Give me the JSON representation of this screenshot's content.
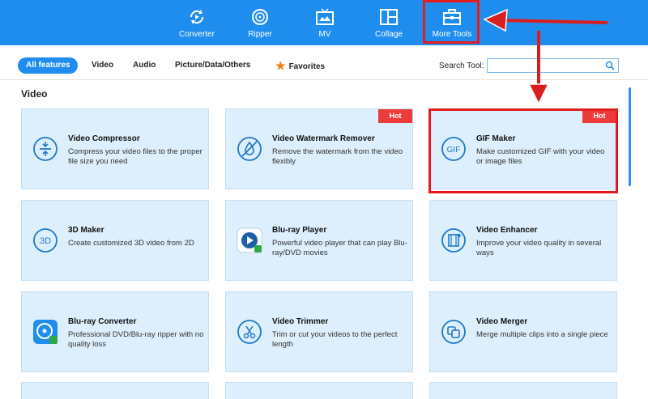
{
  "nav": {
    "items": [
      {
        "label": "Converter",
        "icon": "converter-icon"
      },
      {
        "label": "Ripper",
        "icon": "ripper-icon"
      },
      {
        "label": "MV",
        "icon": "mv-icon"
      },
      {
        "label": "Collage",
        "icon": "collage-icon"
      },
      {
        "label": "More Tools",
        "icon": "toolbox-icon",
        "active": true
      }
    ]
  },
  "filters": {
    "items": [
      "All features",
      "Video",
      "Audio",
      "Picture/Data/Others",
      "Favorites"
    ],
    "active": "All features"
  },
  "search": {
    "label": "Search Tool:",
    "placeholder": ""
  },
  "section": {
    "title": "Video"
  },
  "cards": [
    {
      "title": "Video Compressor",
      "desc": "Compress your video files to the proper file size you need",
      "icon": "compress-icon",
      "badge": ""
    },
    {
      "title": "Video Watermark Remover",
      "desc": "Remove the watermark from the video flexibly",
      "icon": "watermark-remove-icon",
      "badge": "Hot"
    },
    {
      "title": "GIF Maker",
      "desc": "Make customized GIF with your video or image files",
      "icon": "gif-icon",
      "badge": "Hot"
    },
    {
      "title": "3D Maker",
      "desc": "Create customized 3D video from 2D",
      "icon": "3d-icon",
      "badge": ""
    },
    {
      "title": "Blu-ray Player",
      "desc": "Powerful video player that can play Blu-ray/DVD movies",
      "icon": "bluray-player-icon",
      "badge": ""
    },
    {
      "title": "Video Enhancer",
      "desc": "Improve your video quality in several ways",
      "icon": "enhance-icon",
      "badge": ""
    },
    {
      "title": "Blu-ray Converter",
      "desc": "Professional DVD/Blu-ray ripper with no quality loss",
      "icon": "bluray-converter-icon",
      "badge": ""
    },
    {
      "title": "Video Trimmer",
      "desc": "Trim or cut your videos to the perfect length",
      "icon": "scissors-icon",
      "badge": ""
    },
    {
      "title": "Video Merger",
      "desc": "Merge multiple clips into a single piece",
      "icon": "merge-icon",
      "badge": ""
    }
  ],
  "colors": {
    "accent": "#1f8ded",
    "hot": "#ed3b3b",
    "highlight": "#e31d1d",
    "card_bg": "#ddeffc"
  }
}
